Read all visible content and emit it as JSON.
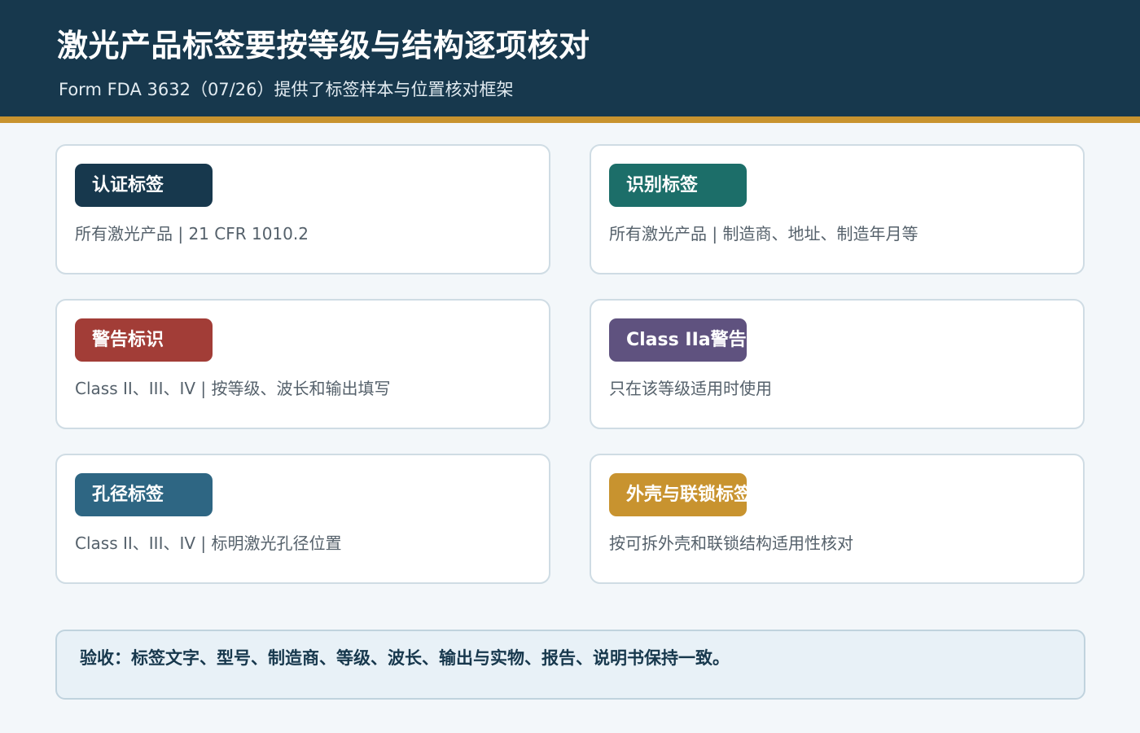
{
  "header": {
    "title": "激光产品标签要按等级与结构逐项核对",
    "subtitle": "Form FDA 3632（07/26）提供了标签样本与位置核对框架"
  },
  "cards": [
    {
      "badge": "认证标签",
      "badge_color": "#17384d",
      "desc": "所有激光产品 | 21 CFR 1010.2"
    },
    {
      "badge": "识别标签",
      "badge_color": "#1c6e69",
      "desc": "所有激光产品 | 制造商、地址、制造年月等"
    },
    {
      "badge": "警告标识",
      "badge_color": "#a23d37",
      "desc": "Class II、III、IV | 按等级、波长和输出填写"
    },
    {
      "badge": "Class IIa警告",
      "badge_color": "#5f527f",
      "desc": "只在该等级适用时使用"
    },
    {
      "badge": "孔径标签",
      "badge_color": "#2e6683",
      "desc": "Class II、III、IV | 标明激光孔径位置"
    },
    {
      "badge": "外壳与联锁标签",
      "badge_color": "#c8932f",
      "desc": "按可拆外壳和联锁结构适用性核对"
    }
  ],
  "footer": {
    "text": "验收：标签文字、型号、制造商、等级、波长、输出与实物、报告、说明书保持一致。"
  },
  "colors": {
    "header_bg": "#17384d",
    "accent_bar": "#c8932f",
    "page_bg": "#f3f7fa"
  }
}
